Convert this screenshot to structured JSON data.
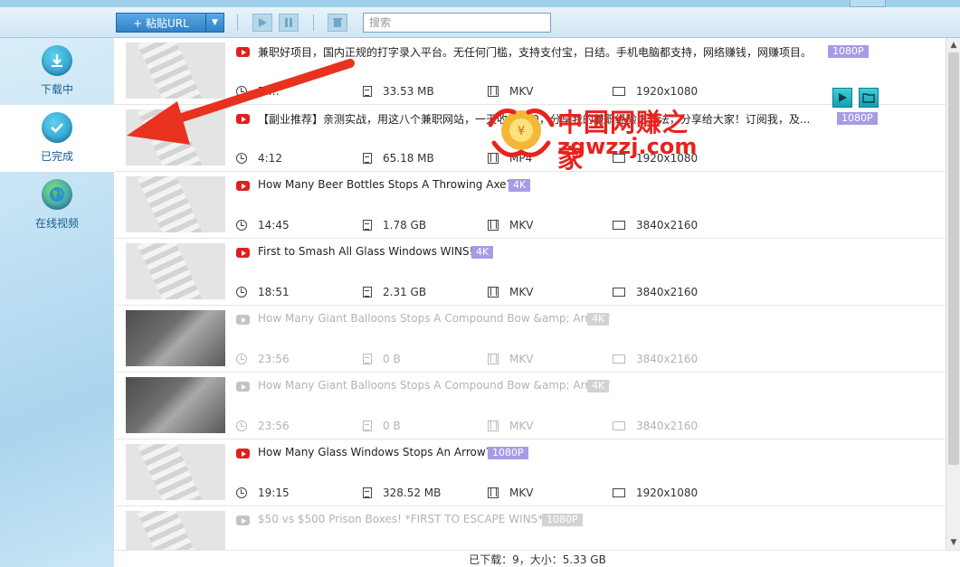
{
  "toolbar": {
    "paste_label": "+ 粘贴URL",
    "search_placeholder": "搜索"
  },
  "sidebar": {
    "items": [
      {
        "label": "下载中",
        "icon": "download-icon"
      },
      {
        "label": "已完成",
        "icon": "check-icon"
      },
      {
        "label": "在线视频",
        "icon": "globe-icon"
      }
    ],
    "active": "已完成"
  },
  "rows": [
    {
      "title": "兼职好项目，国内正规的打字录入平台。无任何门槛，支持支付宝，日结。手机电脑都支持，网络赚钱，网赚项目。",
      "quality": "1080P",
      "duration": "7:…",
      "size": "33.53 MB",
      "format": "MKV",
      "resolution": "1920x1080",
      "dim": false,
      "thumb": "placeholder"
    },
    {
      "title": "【副业推荐】亲测实战，用这八个兼职网站，一天收入400，分享我的兼职经验之方法，分享给大家！订阅我，及...",
      "quality": "1080P",
      "duration": "4:12",
      "size": "65.18 MB",
      "format": "MP4",
      "resolution": "1920x1080",
      "dim": false,
      "thumb": "placeholder"
    },
    {
      "title": "How Many Beer Bottles Stops A Throwing Axe?",
      "quality": "4K",
      "duration": "14:45",
      "size": "1.78 GB",
      "format": "MKV",
      "resolution": "3840x2160",
      "dim": false,
      "thumb": "placeholder"
    },
    {
      "title": "First to Smash All Glass Windows WINS!!",
      "quality": "4K",
      "duration": "18:51",
      "size": "2.31 GB",
      "format": "MKV",
      "resolution": "3840x2160",
      "dim": false,
      "thumb": "placeholder"
    },
    {
      "title": "How Many Giant Balloons Stops A Compound Bow &amp; Arrow?",
      "quality": "4K",
      "duration": "23:56",
      "size": "0 B",
      "format": "MKV",
      "resolution": "3840x2160",
      "dim": true,
      "thumb": "photo"
    },
    {
      "title": "How Many Giant Balloons Stops A Compound Bow &amp; Arrow?",
      "quality": "4K",
      "duration": "23:56",
      "size": "0 B",
      "format": "MKV",
      "resolution": "3840x2160",
      "dim": true,
      "thumb": "photo"
    },
    {
      "title": "How Many Glass Windows Stops An Arrow?",
      "quality": "1080P",
      "duration": "19:15",
      "size": "328.52 MB",
      "format": "MKV",
      "resolution": "1920x1080",
      "dim": false,
      "thumb": "placeholder"
    },
    {
      "title": "$50 vs $500 Prison Boxes! *FIRST TO ESCAPE WINS*",
      "quality": "1080P",
      "duration": "",
      "size": "",
      "format": "",
      "resolution": "",
      "dim": true,
      "thumb": "placeholder"
    }
  ],
  "status": {
    "text": "已下载：9，大小：5.33 GB"
  },
  "watermark": {
    "text": "中国网赚之家",
    "url": "zgwzzj.com"
  },
  "colors": {
    "accent": "#2f82c6",
    "badge": "#a79be6",
    "annotation_arrow": "#e8321f",
    "youtube": "#e02020"
  }
}
